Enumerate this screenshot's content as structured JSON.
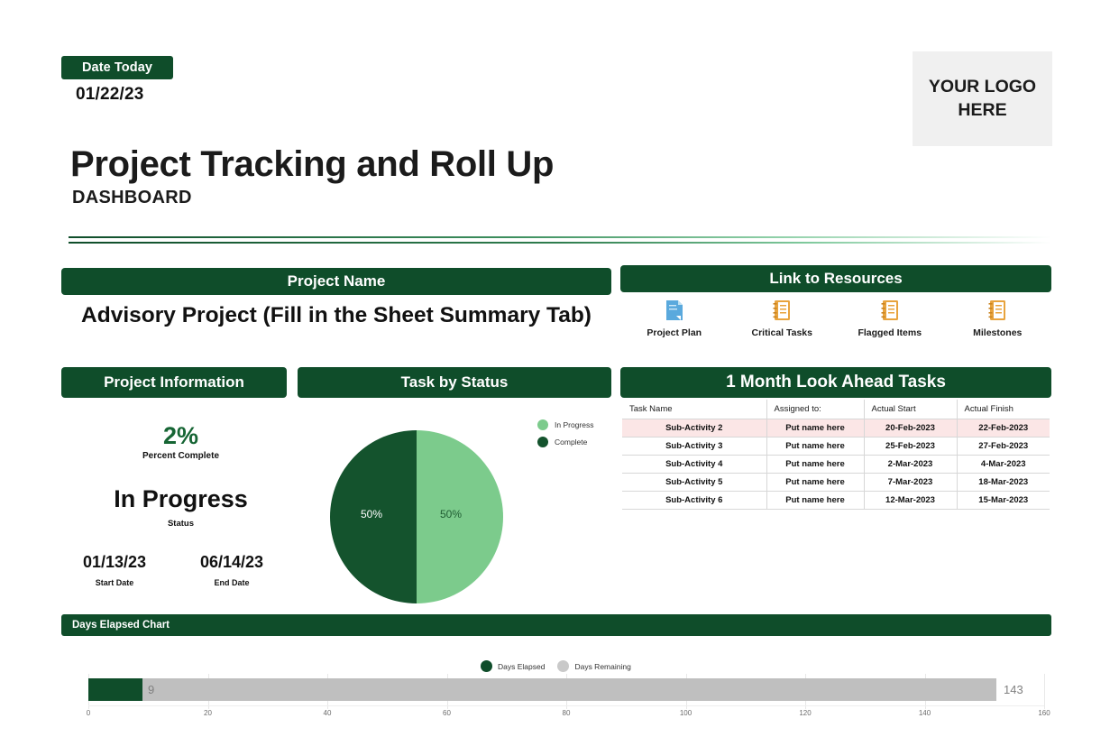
{
  "header": {
    "date_label": "Date Today",
    "date_value": "01/22/23",
    "logo_text": "YOUR LOGO HERE",
    "title": "Project Tracking and Roll Up",
    "subtitle": "DASHBOARD"
  },
  "project_name": {
    "heading": "Project Name",
    "value": "Advisory Project (Fill in the Sheet Summary Tab)"
  },
  "resources": {
    "heading": "Link to Resources",
    "items": [
      {
        "label": "Project Plan",
        "icon": "document-icon",
        "color": "#4a9bd4"
      },
      {
        "label": "Critical Tasks",
        "icon": "notebook-icon",
        "color": "#e8a33d"
      },
      {
        "label": "Flagged Items",
        "icon": "notebook-icon",
        "color": "#e8a33d"
      },
      {
        "label": "Milestones",
        "icon": "notebook-icon",
        "color": "#e8a33d"
      }
    ]
  },
  "project_information": {
    "heading": "Project Information",
    "percent_complete": "2%",
    "percent_complete_label": "Percent Complete",
    "status": "In Progress",
    "status_label": "Status",
    "start_date": "01/13/23",
    "start_date_label": "Start Date",
    "end_date": "06/14/23",
    "end_date_label": "End Date"
  },
  "task_by_status": {
    "heading": "Task by Status"
  },
  "look_ahead": {
    "heading": "1 Month Look Ahead Tasks",
    "columns": [
      "Task Name",
      "Assigned to:",
      "Actual Start",
      "Actual Finish"
    ],
    "rows": [
      {
        "task": "Sub-Activity 2",
        "assigned": "Put name here",
        "start": "20-Feb-2023",
        "finish": "22-Feb-2023",
        "highlight": true
      },
      {
        "task": "Sub-Activity 3",
        "assigned": "Put name here",
        "start": "25-Feb-2023",
        "finish": "27-Feb-2023",
        "highlight": false
      },
      {
        "task": "Sub-Activity 4",
        "assigned": "Put name here",
        "start": "2-Mar-2023",
        "finish": "4-Mar-2023",
        "highlight": false
      },
      {
        "task": "Sub-Activity 5",
        "assigned": "Put name here",
        "start": "7-Mar-2023",
        "finish": "18-Mar-2023",
        "highlight": false
      },
      {
        "task": "Sub-Activity 6",
        "assigned": "Put name here",
        "start": "12-Mar-2023",
        "finish": "15-Mar-2023",
        "highlight": false
      }
    ]
  },
  "days_elapsed": {
    "heading": "Days Elapsed Chart"
  },
  "colors": {
    "brand_dark_green": "#0f4d2a",
    "pie_complete": "#14532d",
    "pie_in_progress": "#7ccb8c",
    "days_elapsed": "#0f4d2a",
    "days_remaining": "#bfbfbf",
    "highlight_row": "#fbe6e6",
    "logo_bg": "#f0f0f0"
  },
  "chart_data": [
    {
      "type": "pie",
      "title": "Task by Status",
      "labels": [
        "In Progress",
        "Complete"
      ],
      "values": [
        50,
        50
      ],
      "value_labels": [
        "50%",
        "50%"
      ],
      "colors": [
        "#7ccb8c",
        "#14532d"
      ],
      "legend": "right",
      "legend_entries": [
        "In Progress",
        "Complete"
      ]
    },
    {
      "type": "bar",
      "orientation": "horizontal",
      "stacked": true,
      "title": "Days Elapsed Chart",
      "categories": [
        ""
      ],
      "series": [
        {
          "name": "Days Elapsed",
          "values": [
            9
          ],
          "color": "#0f4d2a"
        },
        {
          "name": "Days Remaining",
          "values": [
            143
          ],
          "color": "#bfbfbf"
        }
      ],
      "data_labels": [
        "9",
        "143"
      ],
      "xlabel": "",
      "ylabel": "",
      "xlim": [
        0,
        160
      ],
      "xticks": [
        "0",
        "20",
        "40",
        "60",
        "80",
        "100",
        "120",
        "140",
        "160"
      ],
      "grid": true,
      "legend": "top"
    }
  ]
}
